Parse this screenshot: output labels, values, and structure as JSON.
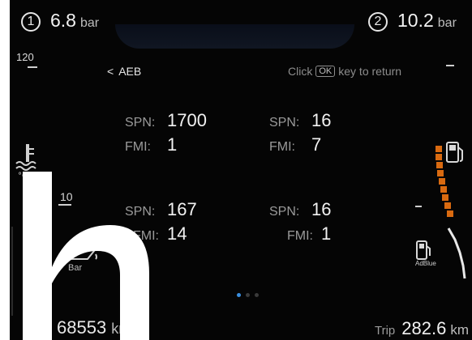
{
  "pressure": [
    {
      "index": "1",
      "value": "6.8",
      "unit": "bar"
    },
    {
      "index": "2",
      "value": "10.2",
      "unit": "bar"
    }
  ],
  "gauge": {
    "scale_top": "120",
    "scale_mid": "10",
    "oil_unit": "Bar"
  },
  "header": {
    "back_label": "AEB",
    "hint_pre": "Click",
    "hint_key": "OK",
    "hint_post": "key to return"
  },
  "faults": [
    {
      "spn_label": "SPN:",
      "spn": "1700",
      "fmi_label": "FMI:",
      "fmi": "1"
    },
    {
      "spn_label": "SPN:",
      "spn": "16",
      "fmi_label": "FMI:",
      "fmi": "7"
    },
    {
      "spn_label": "SPN:",
      "spn": "167",
      "fmi_label": "FMI:",
      "fmi": "14"
    },
    {
      "spn_label": "SPN:",
      "spn": "16",
      "fmi_label": "FMI:",
      "fmi": "1"
    }
  ],
  "pager": {
    "pages": 3,
    "active_page": 1
  },
  "adblue_label": "AdBlue",
  "odometer": {
    "value": "68553",
    "unit": "km"
  },
  "trip": {
    "label": "Trip",
    "value": "282.6",
    "unit": "km"
  },
  "overlay_glyph": "h",
  "colors": {
    "background": "#050505",
    "fuel_segment": "#d96a10",
    "adblue_segment": "#e8e8e8",
    "pager_active": "#3a8fe0"
  },
  "icons": [
    "coolant-temp-icon",
    "oil-can-icon",
    "fuel-pump-icon",
    "adblue-pump-icon"
  ]
}
